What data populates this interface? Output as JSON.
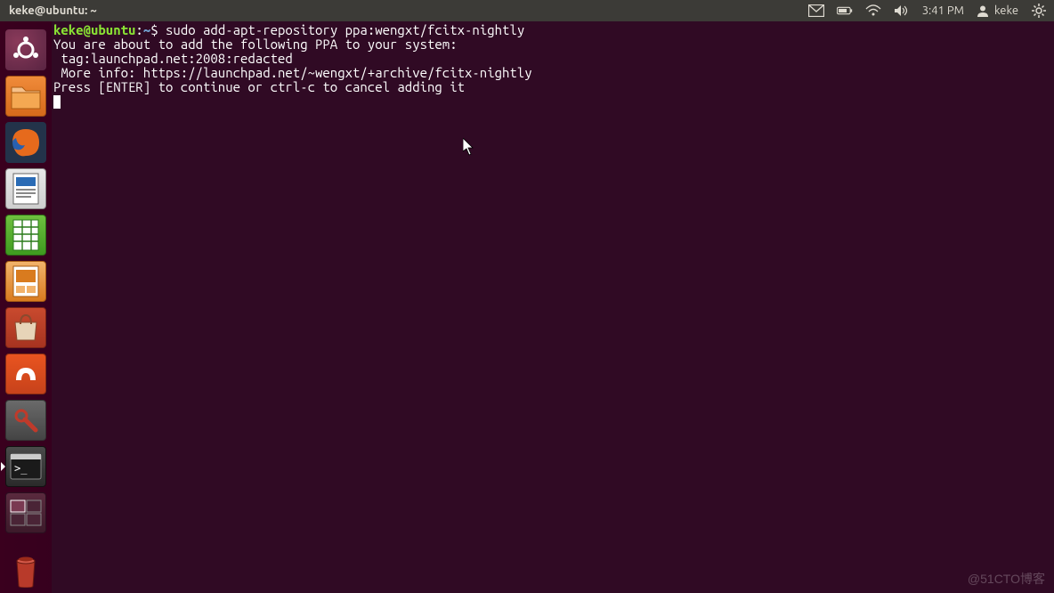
{
  "panel": {
    "window_title": "keke@ubuntu: ~",
    "time": "3:41 PM",
    "username": "keke"
  },
  "launcher": {
    "items": [
      {
        "name": "dash",
        "label": "Dash Home"
      },
      {
        "name": "files",
        "label": "Files"
      },
      {
        "name": "firefox",
        "label": "Firefox"
      },
      {
        "name": "writer",
        "label": "LibreOffice Writer"
      },
      {
        "name": "calc",
        "label": "LibreOffice Calc"
      },
      {
        "name": "impress",
        "label": "LibreOffice Impress"
      },
      {
        "name": "software",
        "label": "Ubuntu Software Center"
      },
      {
        "name": "ubuntuone",
        "label": "Ubuntu One"
      },
      {
        "name": "settings",
        "label": "System Settings"
      },
      {
        "name": "terminal",
        "label": "Terminal"
      },
      {
        "name": "workspace",
        "label": "Workspace Switcher"
      },
      {
        "name": "trash",
        "label": "Trash"
      }
    ]
  },
  "terminal": {
    "prompt_user": "keke@ubuntu",
    "prompt_sep": ":",
    "prompt_path": "~",
    "prompt_dollar": "$ ",
    "command": "sudo add-apt-repository ppa:wengxt/fcitx-nightly",
    "lines": [
      "You are about to add the following PPA to your system:",
      " tag:launchpad.net:2008:redacted",
      " More info: https://launchpad.net/~wengxt/+archive/fcitx-nightly",
      "Press [ENTER] to continue or ctrl-c to cancel adding it"
    ]
  },
  "watermark": "@51CTO博客"
}
